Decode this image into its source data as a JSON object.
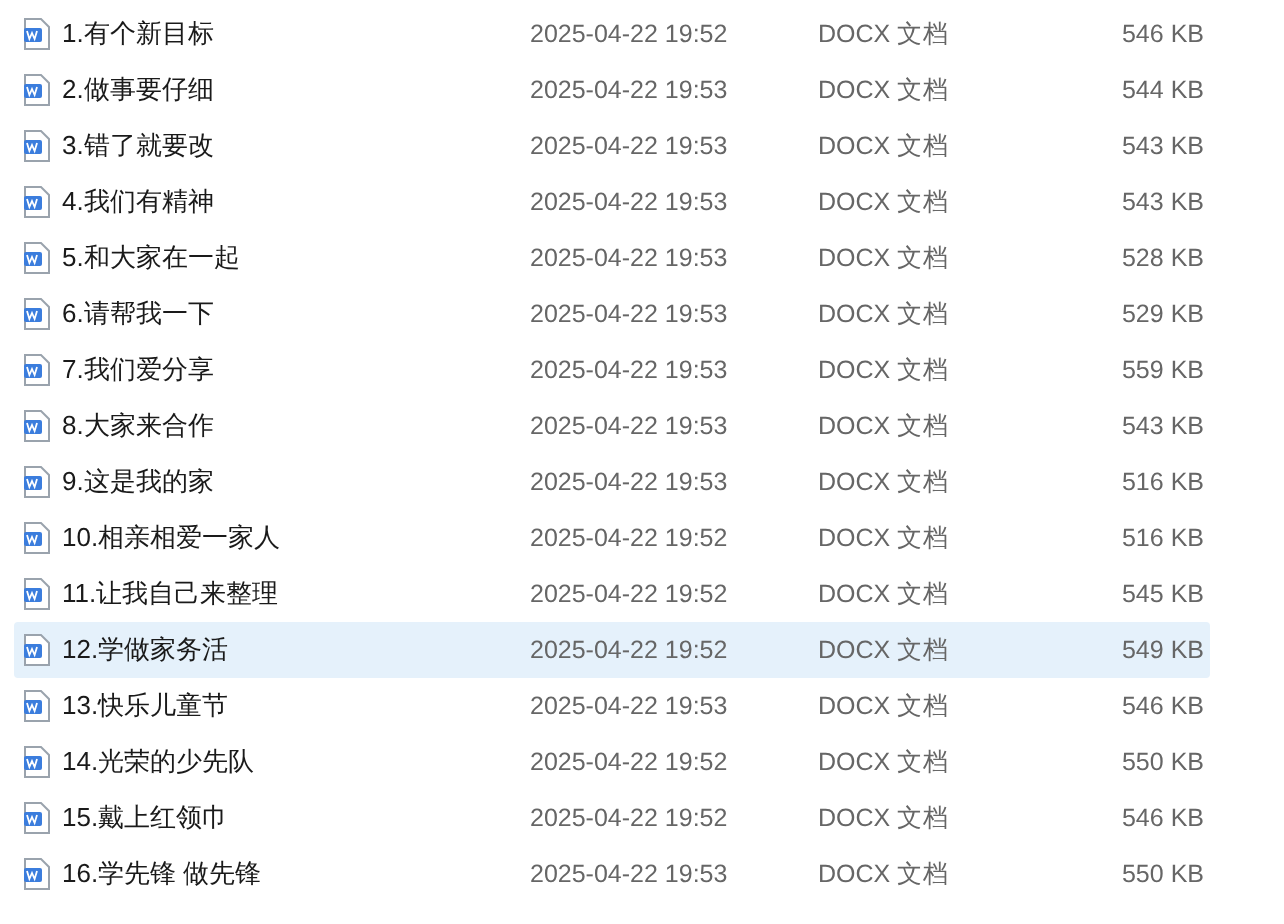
{
  "files": [
    {
      "name": "1.有个新目标",
      "modified": "2025-04-22 19:52",
      "type": "DOCX 文档",
      "size": "546 KB",
      "selected": false
    },
    {
      "name": "2.做事要仔细",
      "modified": "2025-04-22 19:53",
      "type": "DOCX 文档",
      "size": "544 KB",
      "selected": false
    },
    {
      "name": "3.错了就要改",
      "modified": "2025-04-22 19:53",
      "type": "DOCX 文档",
      "size": "543 KB",
      "selected": false
    },
    {
      "name": "4.我们有精神",
      "modified": "2025-04-22 19:53",
      "type": "DOCX 文档",
      "size": "543 KB",
      "selected": false
    },
    {
      "name": "5.和大家在一起",
      "modified": "2025-04-22 19:53",
      "type": "DOCX 文档",
      "size": "528 KB",
      "selected": false
    },
    {
      "name": "6.请帮我一下",
      "modified": "2025-04-22 19:53",
      "type": "DOCX 文档",
      "size": "529 KB",
      "selected": false
    },
    {
      "name": "7.我们爱分享",
      "modified": "2025-04-22 19:53",
      "type": "DOCX 文档",
      "size": "559 KB",
      "selected": false
    },
    {
      "name": "8.大家来合作",
      "modified": "2025-04-22 19:53",
      "type": "DOCX 文档",
      "size": "543 KB",
      "selected": false
    },
    {
      "name": "9.这是我的家",
      "modified": "2025-04-22 19:53",
      "type": "DOCX 文档",
      "size": "516 KB",
      "selected": false
    },
    {
      "name": "10.相亲相爱一家人",
      "modified": "2025-04-22 19:52",
      "type": "DOCX 文档",
      "size": "516 KB",
      "selected": false
    },
    {
      "name": "11.让我自己来整理",
      "modified": "2025-04-22 19:52",
      "type": "DOCX 文档",
      "size": "545 KB",
      "selected": false
    },
    {
      "name": "12.学做家务活",
      "modified": "2025-04-22 19:52",
      "type": "DOCX 文档",
      "size": "549 KB",
      "selected": true
    },
    {
      "name": "13.快乐儿童节",
      "modified": "2025-04-22 19:53",
      "type": "DOCX 文档",
      "size": "546 KB",
      "selected": false
    },
    {
      "name": "14.光荣的少先队",
      "modified": "2025-04-22 19:52",
      "type": "DOCX 文档",
      "size": "550 KB",
      "selected": false
    },
    {
      "name": "15.戴上红领巾",
      "modified": "2025-04-22 19:52",
      "type": "DOCX 文档",
      "size": "546 KB",
      "selected": false
    },
    {
      "name": "16.学先锋 做先锋",
      "modified": "2025-04-22 19:53",
      "type": "DOCX 文档",
      "size": "550 KB",
      "selected": false
    }
  ]
}
